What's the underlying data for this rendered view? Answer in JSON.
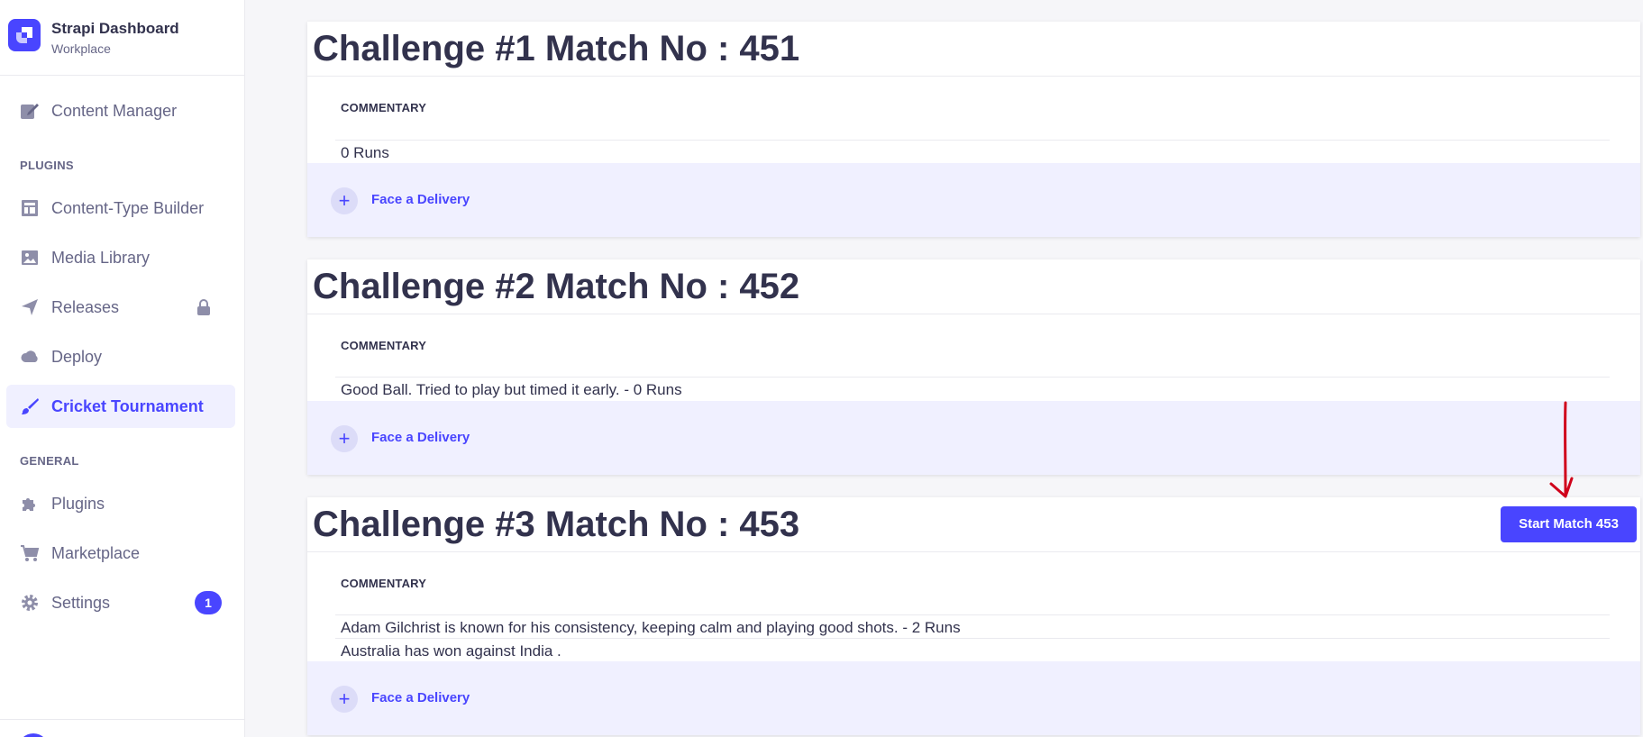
{
  "sidebar": {
    "brand_title": "Strapi Dashboard",
    "brand_subtitle": "Workplace",
    "content_manager": "Content Manager",
    "plugins_section": "PLUGINS",
    "content_type_builder": "Content-Type Builder",
    "media_library": "Media Library",
    "releases": "Releases",
    "deploy": "Deploy",
    "cricket_tournament": "Cricket Tournament",
    "general_section": "GENERAL",
    "plugins": "Plugins",
    "marketplace": "Marketplace",
    "settings": "Settings",
    "settings_badge": "1"
  },
  "challenges": [
    {
      "title": "Challenge #1 Match No : 451",
      "column_header": "COMMENTARY",
      "rows": [
        "0 Runs"
      ],
      "add_label": "Face a Delivery"
    },
    {
      "title": "Challenge #2 Match No : 452",
      "column_header": "COMMENTARY",
      "rows": [
        "Good Ball. Tried to play but timed it early. - 0 Runs"
      ],
      "add_label": "Face a Delivery"
    },
    {
      "title": "Challenge #3 Match No : 453",
      "column_header": "COMMENTARY",
      "rows": [
        "Adam Gilchrist is known for his consistency, keeping calm and playing good shots. - 2 Runs",
        "Australia has won against India ."
      ],
      "add_label": "Face a Delivery",
      "start_button": "Start Match 453"
    }
  ],
  "icons": {
    "brand": "strapi-logo-icon",
    "content_manager": "pen-icon",
    "content_type_builder": "layout-icon",
    "media_library": "image-icon",
    "releases": "paper-plane-icon",
    "deploy": "cloud-icon",
    "cricket_tournament": "brush-icon",
    "plugins": "puzzle-icon",
    "marketplace": "cart-icon",
    "settings": "gear-icon",
    "lock": "lock-icon",
    "plus": "plus-icon"
  },
  "colors": {
    "accent": "#4945ff",
    "accent_light": "#f0f0ff",
    "annotation": "#d0021b"
  }
}
